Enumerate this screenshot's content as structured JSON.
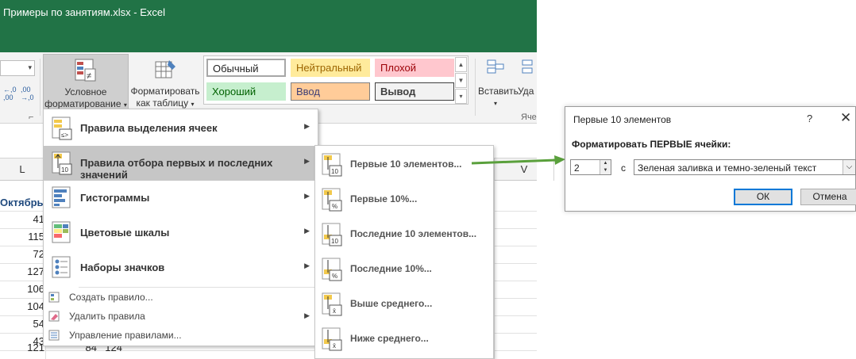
{
  "window": {
    "title": "Примеры по занятиям.xlsx - Excel"
  },
  "ribbon": {
    "cond_format_label_line1": "Условное",
    "cond_format_label_line2": "форматирование",
    "format_table_line1": "Форматировать",
    "format_table_line2": "как таблицу",
    "insert_label": "Вставить",
    "delete_label": "Уда",
    "cells_group_label": "Яче",
    "cell_styles": {
      "normal": "Обычный",
      "neutral": "Нейтральный",
      "bad": "Плохой",
      "good": "Хороший",
      "input": "Ввод",
      "output": "Вывод"
    }
  },
  "sheet": {
    "columns": [
      "L",
      "V"
    ],
    "header_cell": "Октябрь",
    "column_l_values": [
      "41",
      "115",
      "72",
      "127",
      "106",
      "104",
      "54",
      "43",
      "121"
    ],
    "partial_row": [
      "84",
      "124"
    ]
  },
  "cf_menu": {
    "items": [
      {
        "label": "Правила выделения ячеек",
        "icon": "highlight-cells-rules-icon"
      },
      {
        "label": "Правила отбора первых и последних значений",
        "icon": "top-bottom-rules-icon"
      },
      {
        "label": "Гистограммы",
        "icon": "data-bars-icon"
      },
      {
        "label": "Цветовые шкалы",
        "icon": "color-scales-icon"
      },
      {
        "label": "Наборы значков",
        "icon": "icon-sets-icon"
      }
    ],
    "small_items": [
      {
        "label": "Создать правило...",
        "icon": "new-rule-icon"
      },
      {
        "label": "Удалить правила",
        "icon": "clear-rules-icon"
      },
      {
        "label": "Управление правилами...",
        "icon": "manage-rules-icon"
      }
    ]
  },
  "submenu": {
    "items": [
      {
        "label": "Первые 10 элементов...",
        "badge": "10"
      },
      {
        "label": "Первые 10%...",
        "badge": "%"
      },
      {
        "label": "Последние 10 элементов...",
        "badge": "10"
      },
      {
        "label": "Последние 10%...",
        "badge": "%"
      },
      {
        "label": "Выше среднего...",
        "badge": "x̄"
      },
      {
        "label": "Ниже среднего...",
        "badge": "x̄"
      }
    ]
  },
  "dialog": {
    "title": "Первые 10 элементов",
    "help": "?",
    "close": "✕",
    "label": "Форматировать ПЕРВЫЕ ячейки:",
    "count": "2",
    "with_label": "с",
    "format_option": "Зеленая заливка и темно-зеленый текст",
    "ok": "ОК",
    "cancel": "Отмена"
  },
  "colors": {
    "excel_green": "#217346",
    "arrow_green": "#5aa03c",
    "menu_highlight": "#c6c6c6"
  }
}
